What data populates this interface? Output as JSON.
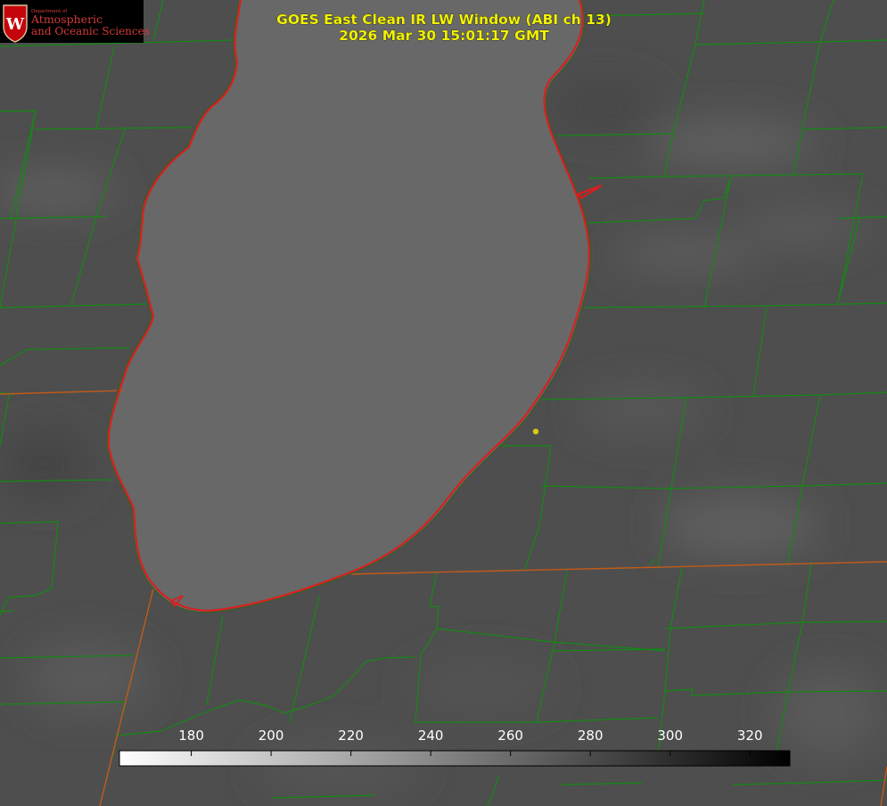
{
  "title": {
    "line1": "GOES East Clean IR LW Window (ABI ch 13)",
    "line2": "2026 Mar 30 15:01:17 GMT"
  },
  "logo": {
    "line_small": "Department of",
    "line1": "Atmospheric",
    "line2": "and Oceanic Sciences",
    "emblem_letter": "W"
  },
  "colorbar": {
    "ticks": [
      "180",
      "200",
      "220",
      "240",
      "260",
      "280",
      "300",
      "320"
    ],
    "tick_values": [
      180,
      200,
      220,
      240,
      260,
      280,
      300,
      320
    ],
    "min_value": 162,
    "max_value": 330,
    "low_color": "#ffffff",
    "high_color": "#000000"
  },
  "colors": {
    "land_gray": "#4e4e4e",
    "lake_gray": "#686868",
    "county_lines": "#138a13",
    "state_lines": "#c25a1a",
    "coastline": "#e01b1b",
    "title_text": "#f2f200",
    "station_marker": "#d8cc10"
  }
}
